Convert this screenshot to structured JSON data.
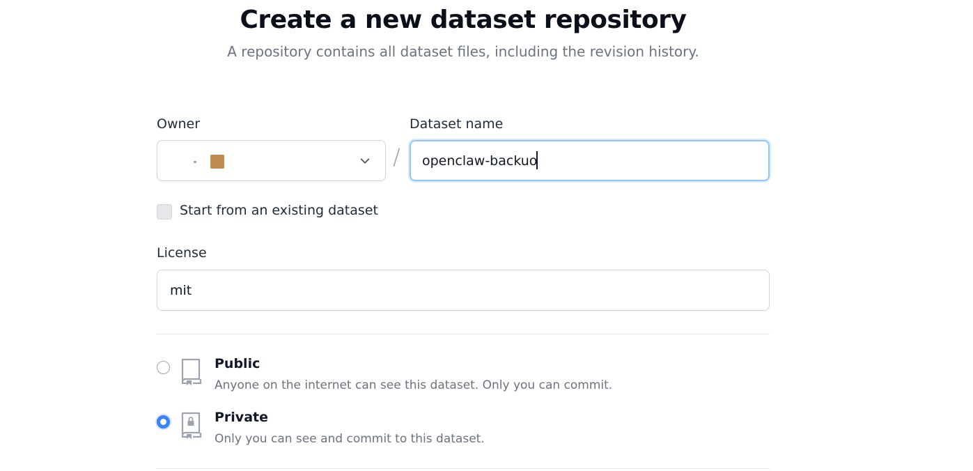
{
  "header": {
    "title": "Create a new dataset repository",
    "subtitle": "A repository contains all dataset files, including the revision history."
  },
  "owner": {
    "label": "Owner",
    "selected": ""
  },
  "dataset_name": {
    "label": "Dataset name",
    "value": "openclaw-backuo"
  },
  "separator": "/",
  "existing": {
    "label": "Start from an existing dataset",
    "checked": false
  },
  "license": {
    "label": "License",
    "value": "mit"
  },
  "visibility": {
    "selected": "private",
    "options": [
      {
        "title": "Public",
        "description": "Anyone on the internet can see this dataset. Only you can commit."
      },
      {
        "title": "Private",
        "description": "Only you can see and commit to this dataset."
      }
    ]
  },
  "colors": {
    "accent": "#3b82f6",
    "focus_ring": "#93c5fd",
    "avatar": "#c08d50"
  }
}
